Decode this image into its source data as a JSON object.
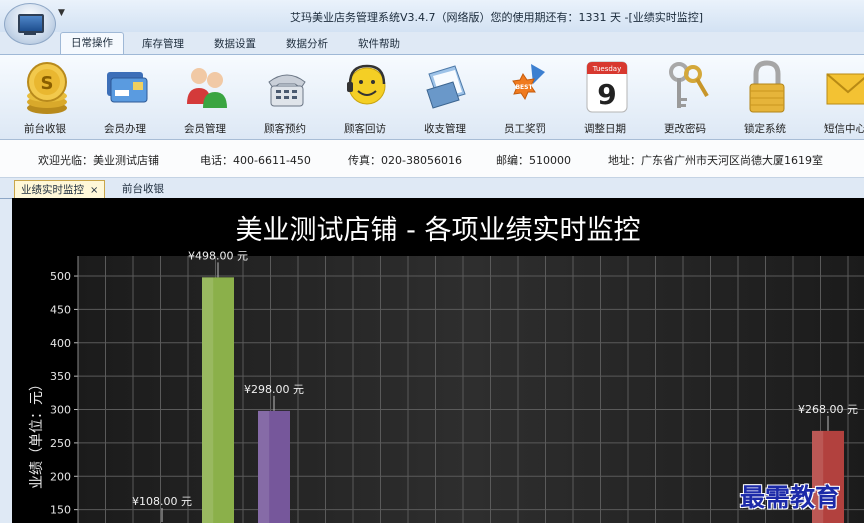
{
  "window": {
    "title": "艾玛美业店务管理系统V3.4.7（网络版）您的使用期还有：1331 天 -[业绩实时监控]"
  },
  "ribbon_tabs": [
    "日常操作",
    "库存管理",
    "数据设置",
    "数据分析",
    "软件帮助"
  ],
  "ribbon_buttons": [
    {
      "label": "前台收银",
      "icon": "coins-icon"
    },
    {
      "label": "会员办理",
      "icon": "member-card-icon"
    },
    {
      "label": "会员管理",
      "icon": "people-icon"
    },
    {
      "label": "顾客预约",
      "icon": "phone-icon"
    },
    {
      "label": "顾客回访",
      "icon": "headset-icon"
    },
    {
      "label": "收支管理",
      "icon": "notebook-icon"
    },
    {
      "label": "员工奖罚",
      "icon": "badge-icon"
    },
    {
      "label": "调整日期",
      "icon": "calendar-icon",
      "calendar_day": "Tuesday",
      "calendar_date": "9"
    },
    {
      "label": "更改密码",
      "icon": "keys-icon"
    },
    {
      "label": "锁定系统",
      "icon": "padlock-icon"
    },
    {
      "label": "短信中心",
      "icon": "envelope-icon"
    }
  ],
  "info": {
    "welcome": "欢迎光临：美业测试店铺",
    "phone": "电话：400-6611-450",
    "fax": "传真：020-38056016",
    "postcode": "邮编：510000",
    "address": "地址：广东省广州市天河区尚德大厦1619室"
  },
  "doc_tabs": [
    {
      "label": "业绩实时监控",
      "close": "×"
    },
    {
      "label": "前台收银"
    }
  ],
  "chart_data": {
    "type": "bar",
    "title": "美业测试店铺 - 各项业绩实时监控",
    "ylabel": "业绩（单位：元）",
    "ylim": [
      130,
      530
    ],
    "yticks": [
      150,
      200,
      250,
      300,
      350,
      400,
      450,
      500
    ],
    "grid": true,
    "bars": [
      {
        "value": 108,
        "label": "¥108.00 元",
        "color": "#5b7fb6"
      },
      {
        "value": 498,
        "label": "¥498.00 元",
        "color": "#8bb04a"
      },
      {
        "value": 298,
        "label": "¥298.00 元",
        "color": "#76579b"
      },
      {
        "value": 268,
        "label": "¥268.00 元",
        "color": "#b2413e"
      }
    ]
  },
  "watermark": "最需教育",
  "colors": {
    "chart_bg": "#000000",
    "grid": "#5a5a5a",
    "ribbon_top": "#f7fbff",
    "accent": "#9fb8d6"
  }
}
